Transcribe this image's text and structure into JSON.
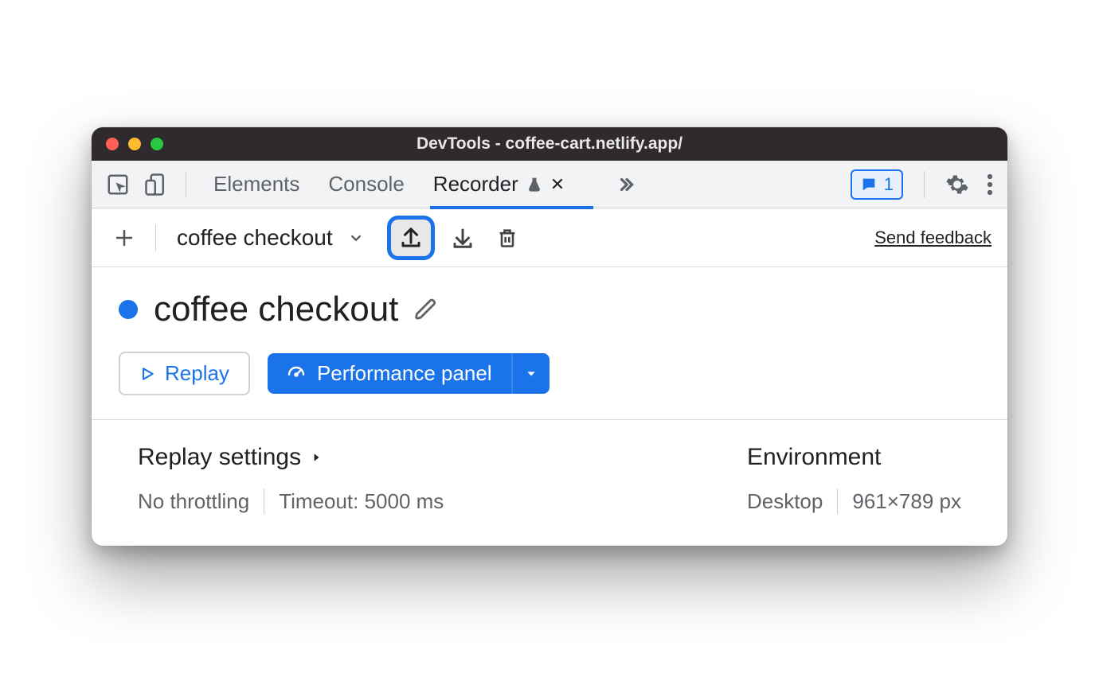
{
  "window": {
    "title": "DevTools - coffee-cart.netlify.app/"
  },
  "tabs": {
    "items": [
      {
        "label": "Elements",
        "active": false
      },
      {
        "label": "Console",
        "active": false
      },
      {
        "label": "Recorder",
        "active": true
      }
    ],
    "issues_count": "1"
  },
  "recorder": {
    "selected_recording": "coffee checkout",
    "feedback_link": "Send feedback",
    "title": "coffee checkout",
    "replay_label": "Replay",
    "performance_label": "Performance panel"
  },
  "replay_settings": {
    "heading": "Replay settings",
    "throttling": "No throttling",
    "timeout": "Timeout: 5000 ms"
  },
  "environment": {
    "heading": "Environment",
    "device": "Desktop",
    "viewport": "961×789 px"
  }
}
